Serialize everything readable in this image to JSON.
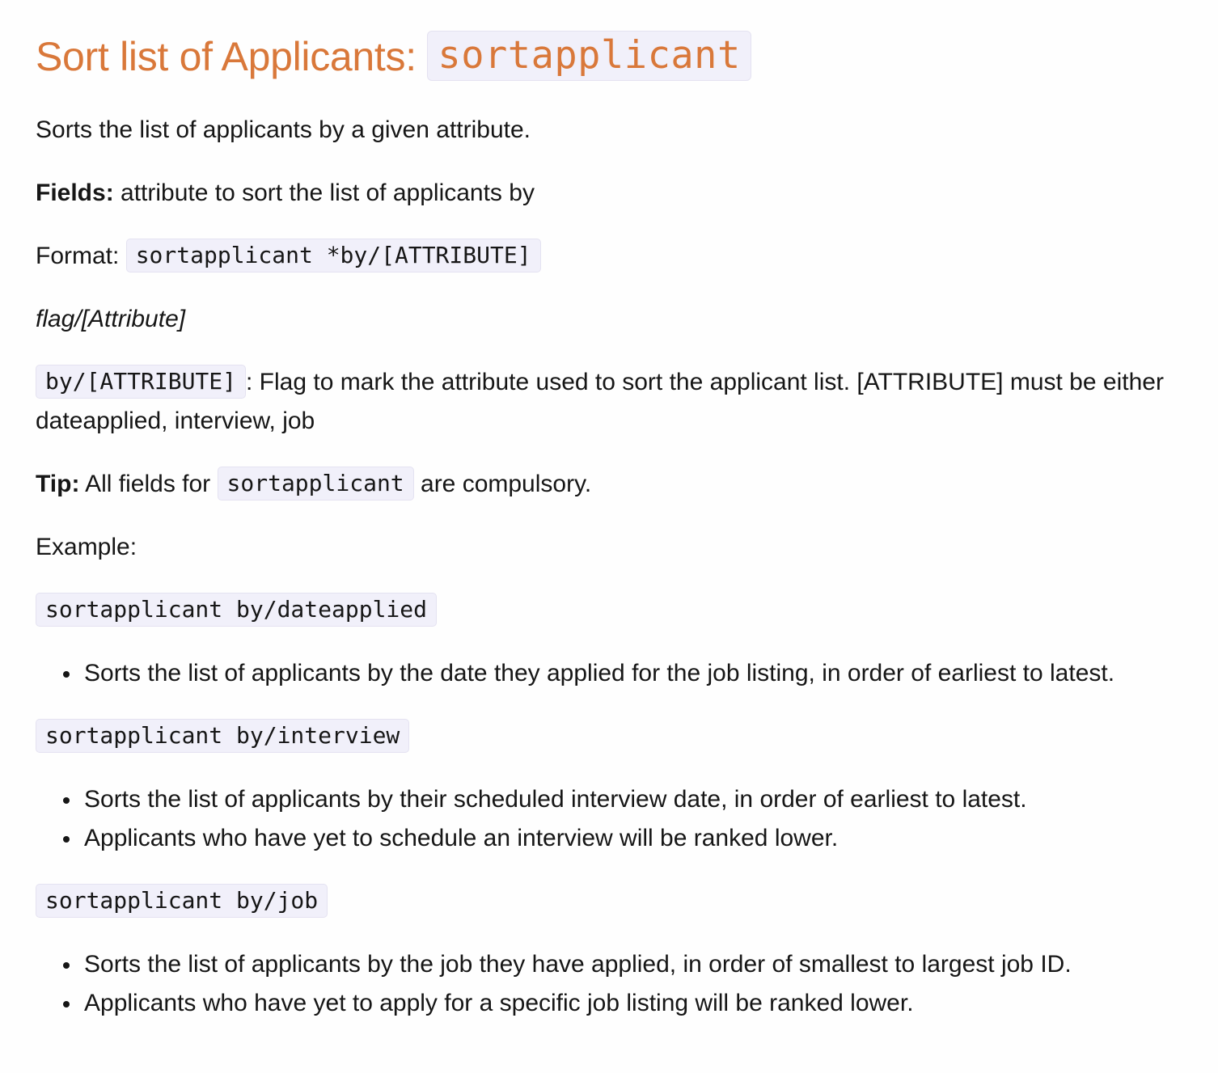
{
  "heading": {
    "text": "Sort list of Applicants: ",
    "code": "sortapplicant"
  },
  "description": "Sorts the list of applicants by a given attribute.",
  "fields": {
    "label": "Fields:",
    "text": " attribute to sort the list of applicants by"
  },
  "format": {
    "label": "Format: ",
    "code": "sortapplicant *by/[ATTRIBUTE]"
  },
  "flag_heading": "flag/[Attribute]",
  "flag_desc": {
    "code": "by/[ATTRIBUTE]",
    "text": ": Flag to mark the attribute used to sort the applicant list. [ATTRIBUTE] must be either dateapplied, interview, job"
  },
  "tip": {
    "label": "Tip:",
    "pre": " All fields for ",
    "code": "sortapplicant",
    "post": " are compulsory."
  },
  "example_label": "Example:",
  "examples": [
    {
      "code": "sortapplicant by/dateapplied",
      "bullets": [
        "Sorts the list of applicants by the date they applied for the job listing, in order of earliest to latest."
      ]
    },
    {
      "code": "sortapplicant by/interview",
      "bullets": [
        "Sorts the list of applicants by their scheduled interview date, in order of earliest to latest.",
        "Applicants who have yet to schedule an interview will be ranked lower."
      ]
    },
    {
      "code": "sortapplicant by/job",
      "bullets": [
        "Sorts the list of applicants by the job they have applied, in order of smallest to largest job ID.",
        "Applicants who have yet to apply for a specific job listing will be ranked lower."
      ]
    }
  ],
  "colors": {
    "heading": "#d9783a",
    "code_background": "#f1f0fa",
    "text": "#161616"
  }
}
